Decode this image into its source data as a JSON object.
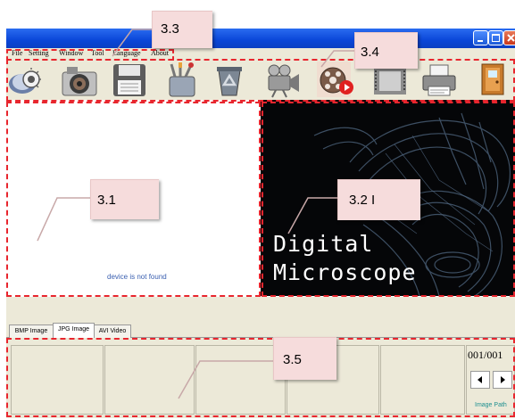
{
  "menu": {
    "items": [
      {
        "label": "File"
      },
      {
        "label": "Setting"
      },
      {
        "label": "Window"
      },
      {
        "label": "Tool"
      },
      {
        "label": "Language"
      },
      {
        "label": "About"
      }
    ]
  },
  "toolbar": {
    "tools": [
      {
        "icon": "capture-icon"
      },
      {
        "icon": "camera-icon"
      },
      {
        "icon": "save-icon"
      },
      {
        "icon": "tools-icon"
      },
      {
        "icon": "recycle-icon"
      },
      {
        "icon": "video-camera-icon"
      },
      {
        "icon": "film-reel-icon"
      },
      {
        "icon": "film-strip-icon"
      },
      {
        "icon": "printer-icon"
      },
      {
        "icon": "exit-door-icon"
      }
    ]
  },
  "preview": {
    "status_text": "device is not found"
  },
  "splash": {
    "line1": "Digital",
    "line2": "Microscope"
  },
  "tabs": [
    {
      "label": "BMP Image"
    },
    {
      "label": "JPG Image"
    },
    {
      "label": "AVI Video"
    }
  ],
  "gallery": {
    "page_counter": "001/001",
    "image_path_label": "Image Path"
  },
  "annotations": {
    "menu_callout": "3.3",
    "toolbar_callout": "3.4",
    "preview_callout": "3.1",
    "splash_callout": "3.2 I",
    "gallery_callout": "3.5"
  },
  "colors": {
    "annotation_red": "#e8262e",
    "titlebar_blue": "#0a46d8",
    "status_blue": "#3a5fb0"
  }
}
